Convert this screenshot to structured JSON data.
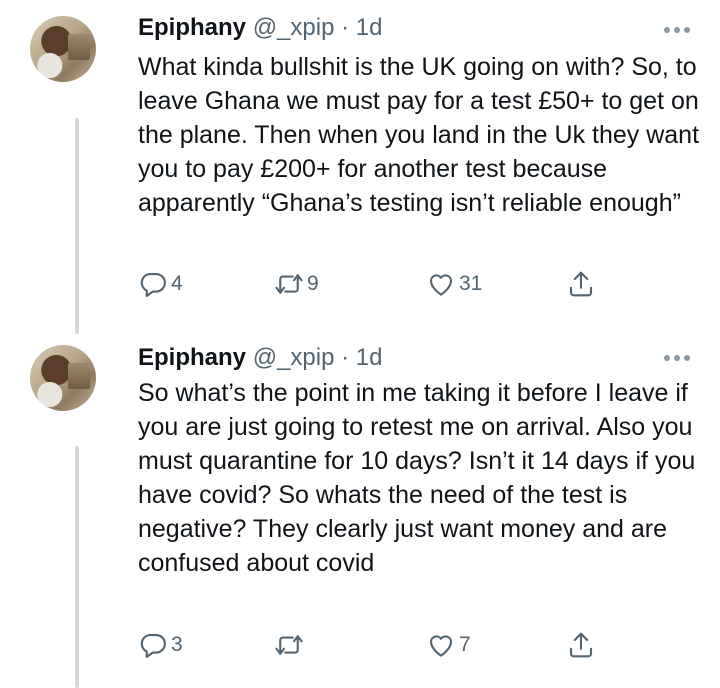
{
  "tweets": [
    {
      "name": "Epiphany",
      "handle": "@_xpip",
      "separator": "·",
      "time": "1d",
      "text": "What kinda bullshit is the UK going on with? So, to leave Ghana we must pay for a test £50+ to get on the plane. Then when you land in the Uk they want you to pay £200+ for another test because apparently “Ghana’s testing isn’t reliable enough”",
      "replies": "4",
      "retweets": "9",
      "likes": "31"
    },
    {
      "name": "Epiphany",
      "handle": "@_xpip",
      "separator": "·",
      "time": "1d",
      "text": "So what’s the point in me taking it before I leave if you are just going to retest me on arrival. Also you must quarantine for 10 days? Isn’t it 14 days if you have covid? So whats the need of the test is negative? They clearly just want money and are confused about covid",
      "replies": "3",
      "retweets": "",
      "likes": "7"
    }
  ],
  "icons": {
    "reply": "reply-icon",
    "retweet": "retweet-icon",
    "like": "heart-icon",
    "share": "share-icon",
    "more": "more-icon"
  },
  "colors": {
    "text": "#0f1419",
    "secondary": "#536471",
    "thread_line": "#cfd9de"
  }
}
